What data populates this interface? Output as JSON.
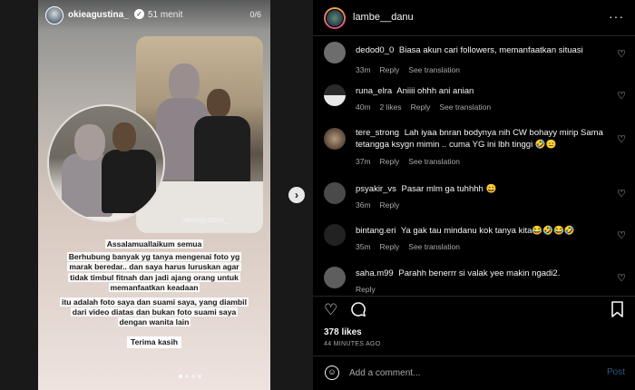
{
  "story": {
    "username": "okieagustina_",
    "time": "51 menit",
    "count": "0/6",
    "watermark": "okieagustina_",
    "caption_lines": [
      "Assalamuallaikum semua",
      "Berhubung banyak yg tanya mengenai foto yg",
      "marak beredar.. dan saya harus luruskan agar",
      "tidak timbul fitnah dan jadi ajang orang untuk",
      "memanfaatkan keadaan",
      "itu adalah foto saya dan suami saya, yang diambil",
      "dari video diatas dan bukan foto suami saya",
      "dengan wanita lain"
    ],
    "thanks": "Terima kasih"
  },
  "header": {
    "username": "lambe__danu",
    "more_icon": "more-icon"
  },
  "comments": [
    {
      "user": "dedod0_0",
      "text": "Biasa akun cari followers, memanfaatkan situasi",
      "time": "33m",
      "likes": "",
      "reply": "Reply",
      "translate": "See translation",
      "avatar_color": "#6d6d6d"
    },
    {
      "user": "runa_elra",
      "text": "Aniiii ohhh ani anian",
      "time": "40m",
      "likes": "2 likes",
      "reply": "Reply",
      "translate": "See translation",
      "avatar_color": "#3b3b3b"
    },
    {
      "user": "tere_strong",
      "text": "Lah iyaa bnran bodynya nih CW bohayy mirip Sama tetangga ksygn mimin .. cuma YG ini lbh tinggi 🤣😑",
      "time": "37m",
      "likes": "",
      "reply": "Reply",
      "translate": "See translation",
      "avatar_color": "#7a6a5a"
    },
    {
      "user": "psyakir_vs",
      "text": "Pasar mlm ga tuhhhh 😄",
      "time": "36m",
      "likes": "",
      "reply": "Reply",
      "translate": "",
      "avatar_color": "#4a4a4a"
    },
    {
      "user": "bintang.eri",
      "text": "Ya gak tau mindanu kok tanya kita😂🤣😂🤣",
      "time": "35m",
      "likes": "",
      "reply": "Reply",
      "translate": "See translation",
      "avatar_color": "#222222"
    },
    {
      "user": "saha.m99",
      "text": "Parahh benerrr si valak yee makin ngadi2.",
      "time": "",
      "likes": "",
      "reply": "Reply",
      "translate": "",
      "avatar_color": "#5e5e5e"
    }
  ],
  "actions": {
    "heart_icon": "heart-icon",
    "comment_icon": "comment-icon",
    "bookmark_icon": "bookmark-icon"
  },
  "likes": "378 likes",
  "ago": "44 MINUTES AGO",
  "add_comment": {
    "placeholder": "Add a comment...",
    "post_label": "Post"
  }
}
